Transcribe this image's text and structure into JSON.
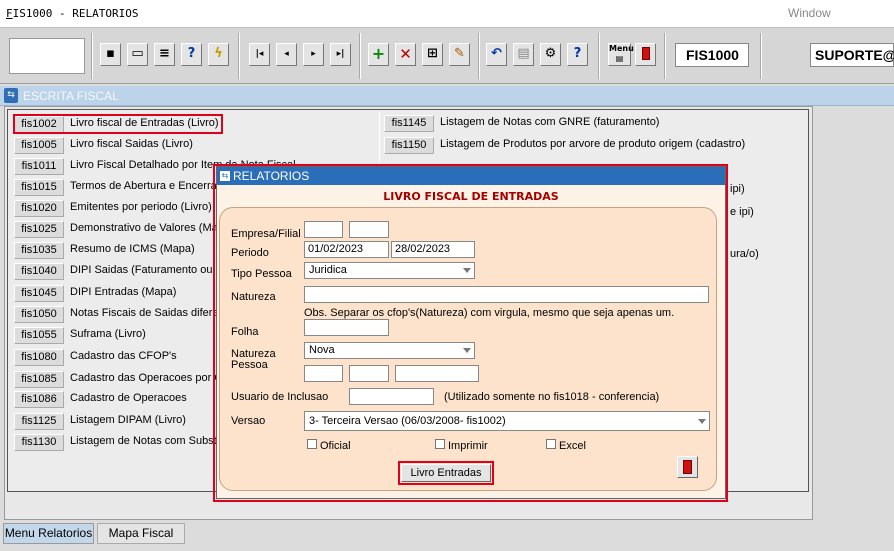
{
  "window": {
    "title": "FIS1000 - RELATORIOS",
    "menu": "Window"
  },
  "toolbar": {
    "form_id": "FIS1000",
    "user": "SUPORTE@",
    "menu_button": "Menu"
  },
  "stripe_title": "ESCRITA FISCAL",
  "left_list": [
    {
      "code": "fis1002",
      "desc": "Livro fiscal de Entradas (Livro)"
    },
    {
      "code": "fis1005",
      "desc": "Livro fiscal Saidas (Livro)"
    },
    {
      "code": "fis1011",
      "desc": "Livro Fiscal Detalhado por Item da Nota Fiscal"
    },
    {
      "code": "fis1015",
      "desc": "Termos de Abertura e Encerramento"
    },
    {
      "code": "fis1020",
      "desc": "Emitentes por periodo (Livro)"
    },
    {
      "code": "fis1025",
      "desc": "Demonstrativo de Valores (Mapa)"
    },
    {
      "code": "fis1035",
      "desc": "Resumo de ICMS (Mapa)"
    },
    {
      "code": "fis1040",
      "desc": "DIPI Saidas (Faturamento ou Mapa)"
    },
    {
      "code": "fis1045",
      "desc": "DIPI Entradas (Mapa)"
    },
    {
      "code": "fis1050",
      "desc": "Notas Fiscais de Saidas diferenciadas"
    },
    {
      "code": "fis1055",
      "desc": "Suframa (Livro)"
    },
    {
      "code": "fis1080",
      "desc": "Cadastro das CFOP's"
    },
    {
      "code": "fis1085",
      "desc": "Cadastro das Operacoes por CFOP"
    },
    {
      "code": "fis1086",
      "desc": "Cadastro de Operacoes"
    },
    {
      "code": "fis1125",
      "desc": "Listagem DIPAM (Livro)"
    },
    {
      "code": "fis1130",
      "desc": "Listagem de Notas com Substituicao"
    }
  ],
  "right_list": [
    {
      "code": "fis1145",
      "desc": "Listagem de Notas com GNRE (faturamento)"
    },
    {
      "code": "fis1150",
      "desc": "Listagem de Produtos por arvore de produto origem (cadastro)"
    }
  ],
  "right_fragments": [
    "ipi)",
    "e ipi)",
    "ura/o)"
  ],
  "modal": {
    "title": "RELATORIOS",
    "heading": "LIVRO FISCAL DE ENTRADAS",
    "labels": {
      "empresa": "Empresa/Filial",
      "periodo": "Periodo",
      "tipo_pessoa": "Tipo Pessoa",
      "natureza": "Natureza",
      "obs": "Obs. Separar os cfop's(Natureza) com virgula, mesmo que seja  apenas um.",
      "folha": "Folha",
      "natureza_pessoa_1": "Natureza",
      "natureza_pessoa_2": "Pessoa",
      "usuario": "Usuario de Inclusao",
      "usuario_note": "(Utilizado somente  no fis1018 - conferencia)",
      "versao": "Versao"
    },
    "values": {
      "periodo_ini": "01/02/2023",
      "periodo_fim": "28/02/2023",
      "tipo_pessoa": "Juridica",
      "natureza_pessoa": "Nova",
      "versao": "3- Terceira Versao (06/03/2008- fis1002)"
    },
    "checkboxes": {
      "oficial": "Oficial",
      "imprimir": "Imprimir",
      "excel": "Excel"
    },
    "submit": "Livro Entradas"
  },
  "tabs": [
    "Menu Relatorios",
    "Mapa Fiscal"
  ]
}
